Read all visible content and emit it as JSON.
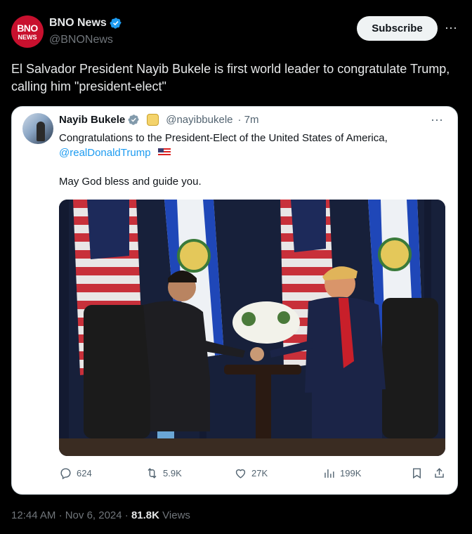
{
  "header": {
    "avatar_text_top": "BNO",
    "avatar_text_bottom": "NEWS",
    "author_name": "BNO News",
    "handle": "@BNONews",
    "subscribe_label": "Subscribe",
    "more_label": "···"
  },
  "tweet": {
    "text": "El Salvador President Nayib Bukele is first world leader to congratulate Trump, calling him \"president-elect\""
  },
  "quote": {
    "author_name": "Nayib Bukele",
    "handle": "@nayibbukele",
    "time": "· 7m",
    "more_label": "···",
    "line1": "Congratulations to the President-Elect of the United States of America,",
    "mention": "@realDonaldTrump",
    "line2": "May God bless and guide you.",
    "actions": {
      "replies": "624",
      "reposts": "5.9K",
      "likes": "27K",
      "views": "199K"
    }
  },
  "meta": {
    "time": "12:44 AM",
    "date": "· Nov 6, 2024 ·",
    "views_count": "81.8K",
    "views_label": "Views"
  },
  "colors": {
    "accent": "#1d9bf0",
    "brand_red": "#c8102e",
    "background": "#000000"
  }
}
